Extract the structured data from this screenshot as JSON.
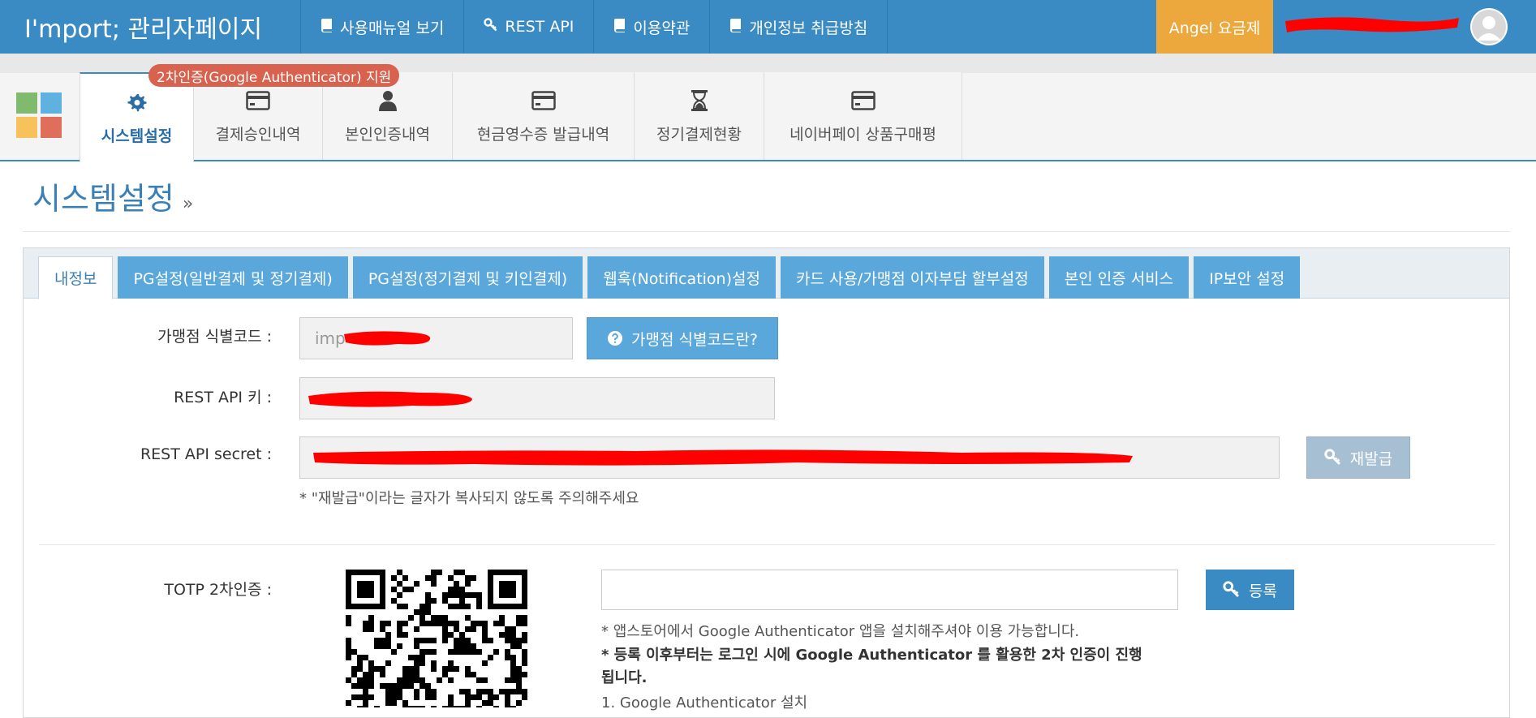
{
  "header": {
    "brand": "I'mport; 관리자페이지",
    "nav": [
      {
        "icon": "book-icon",
        "label": "사용매뉴얼 보기"
      },
      {
        "icon": "key-icon",
        "label": "REST API"
      },
      {
        "icon": "book-icon",
        "label": "이용약관"
      },
      {
        "icon": "book-icon",
        "label": "개인정보 취급방침"
      }
    ],
    "plan": "Angel 요금제"
  },
  "modules": {
    "notice": "2차인증(Google Authenticator) 지원",
    "tabs": [
      {
        "icon": "gear-icon",
        "label": "시스템설정",
        "active": true
      },
      {
        "icon": "credit-card-icon",
        "label": "결제승인내역"
      },
      {
        "icon": "user-icon",
        "label": "본인인증내역"
      },
      {
        "icon": "credit-card-icon",
        "label": "현금영수증 발급내역"
      },
      {
        "icon": "hourglass-icon",
        "label": "정기결제현황"
      },
      {
        "icon": "credit-card-icon",
        "label": "네이버페이 상품구매평"
      }
    ]
  },
  "page": {
    "title": "시스템설정",
    "title_suffix": "»"
  },
  "panel": {
    "tabs": [
      {
        "label": "내정보",
        "active": true
      },
      {
        "label": "PG설정(일반결제 및 정기결제)"
      },
      {
        "label": "PG설정(정기결제 및 키인결제)"
      },
      {
        "label": "웹훅(Notification)설정"
      },
      {
        "label": "카드 사용/가맹점 이자부담 할부설정"
      },
      {
        "label": "본인 인증 서비스"
      },
      {
        "label": "IP보안 설정"
      }
    ],
    "merchant_code": {
      "label": "가맹점 식별코드 :",
      "value_prefix": "imp",
      "help_button": "가맹점 식별코드란?"
    },
    "api_key": {
      "label": "REST API 키 :"
    },
    "api_secret": {
      "label": "REST API secret :",
      "reissue_button": "재발급",
      "note": "* \"재발급\"이라는 글자가 복사되지 않도록 주의해주세요"
    },
    "totp": {
      "label": "TOTP 2차인증 :",
      "register_button": "등록",
      "input_value": "",
      "note1": "* 앱스토어에서 Google Authenticator 앱을 설치해주셔야 이용 가능합니다.",
      "note2_line1": "* 등록 이후부터는 로그인 시에 Google Authenticator 를 활용한 2차 인증이 진행",
      "note2_line2": "됩니다.",
      "step1": "1. Google Authenticator 설치"
    }
  },
  "colors": {
    "primary": "#3a8ac4",
    "tab_blue": "#5aa7dc",
    "plan": "#eca83c",
    "notice": "#d9624f",
    "redaction": "#ff0000"
  }
}
